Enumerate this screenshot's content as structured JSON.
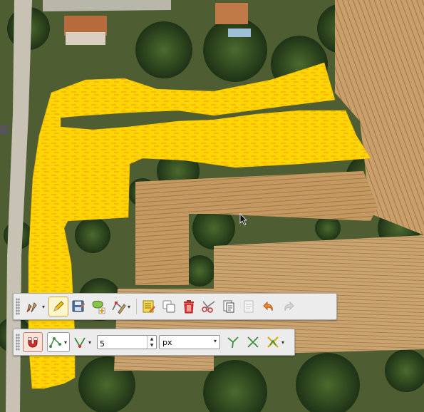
{
  "map": {
    "polygon_fill": "#ffd600",
    "hatch_color": "#f0a020",
    "description_icons": [
      "cursor-icon"
    ]
  },
  "digitizing_toolbar": {
    "tools": [
      {
        "name": "edits-menu-icon"
      },
      {
        "name": "toggle-editing-icon"
      },
      {
        "name": "save-edits-icon"
      },
      {
        "name": "add-polygon-feature-icon"
      },
      {
        "name": "vertex-tool-icon"
      },
      {
        "name": "modify-attributes-icon"
      },
      {
        "name": "copy-features-icon"
      },
      {
        "name": "delete-selected-icon"
      },
      {
        "name": "cut-features-icon"
      },
      {
        "name": "paste-features-icon"
      },
      {
        "name": "copy-icon-disabled"
      },
      {
        "name": "undo-icon"
      },
      {
        "name": "redo-icon"
      }
    ]
  },
  "snapping_toolbar": {
    "tolerance_value": "5",
    "units_value": "px",
    "units_options": [
      "px"
    ]
  }
}
